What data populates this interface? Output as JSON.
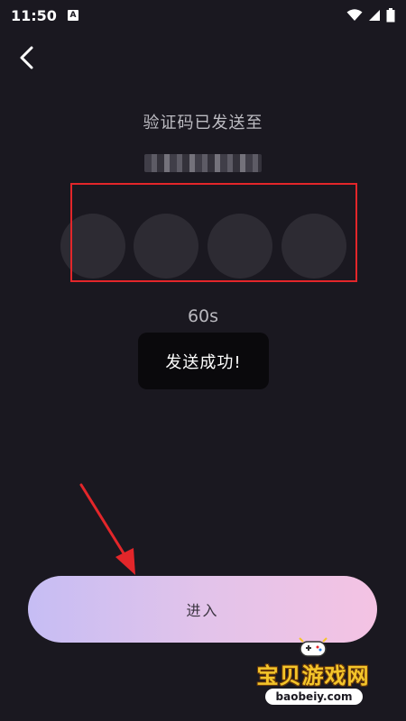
{
  "status_bar": {
    "time": "11:50",
    "notification_icon": "A",
    "icons": [
      "wifi-icon",
      "signal-icon",
      "battery-icon"
    ]
  },
  "header": {
    "back_icon": "chevron-left-icon"
  },
  "main": {
    "title": "验证码已发送至",
    "phone_masked": "",
    "code_digits": [
      "",
      "",
      "",
      ""
    ],
    "countdown": "60s",
    "toast": "发送成功!",
    "enter_button_label": "进入"
  },
  "watermark": {
    "title": "宝贝游戏网",
    "url": "baobeiy.com"
  },
  "colors": {
    "background": "#1a1820",
    "circle": "#2d2b33",
    "annotation_red": "#e3262a",
    "button_gradient_start": "#c6bdf4",
    "button_gradient_end": "#f4c3e3"
  }
}
